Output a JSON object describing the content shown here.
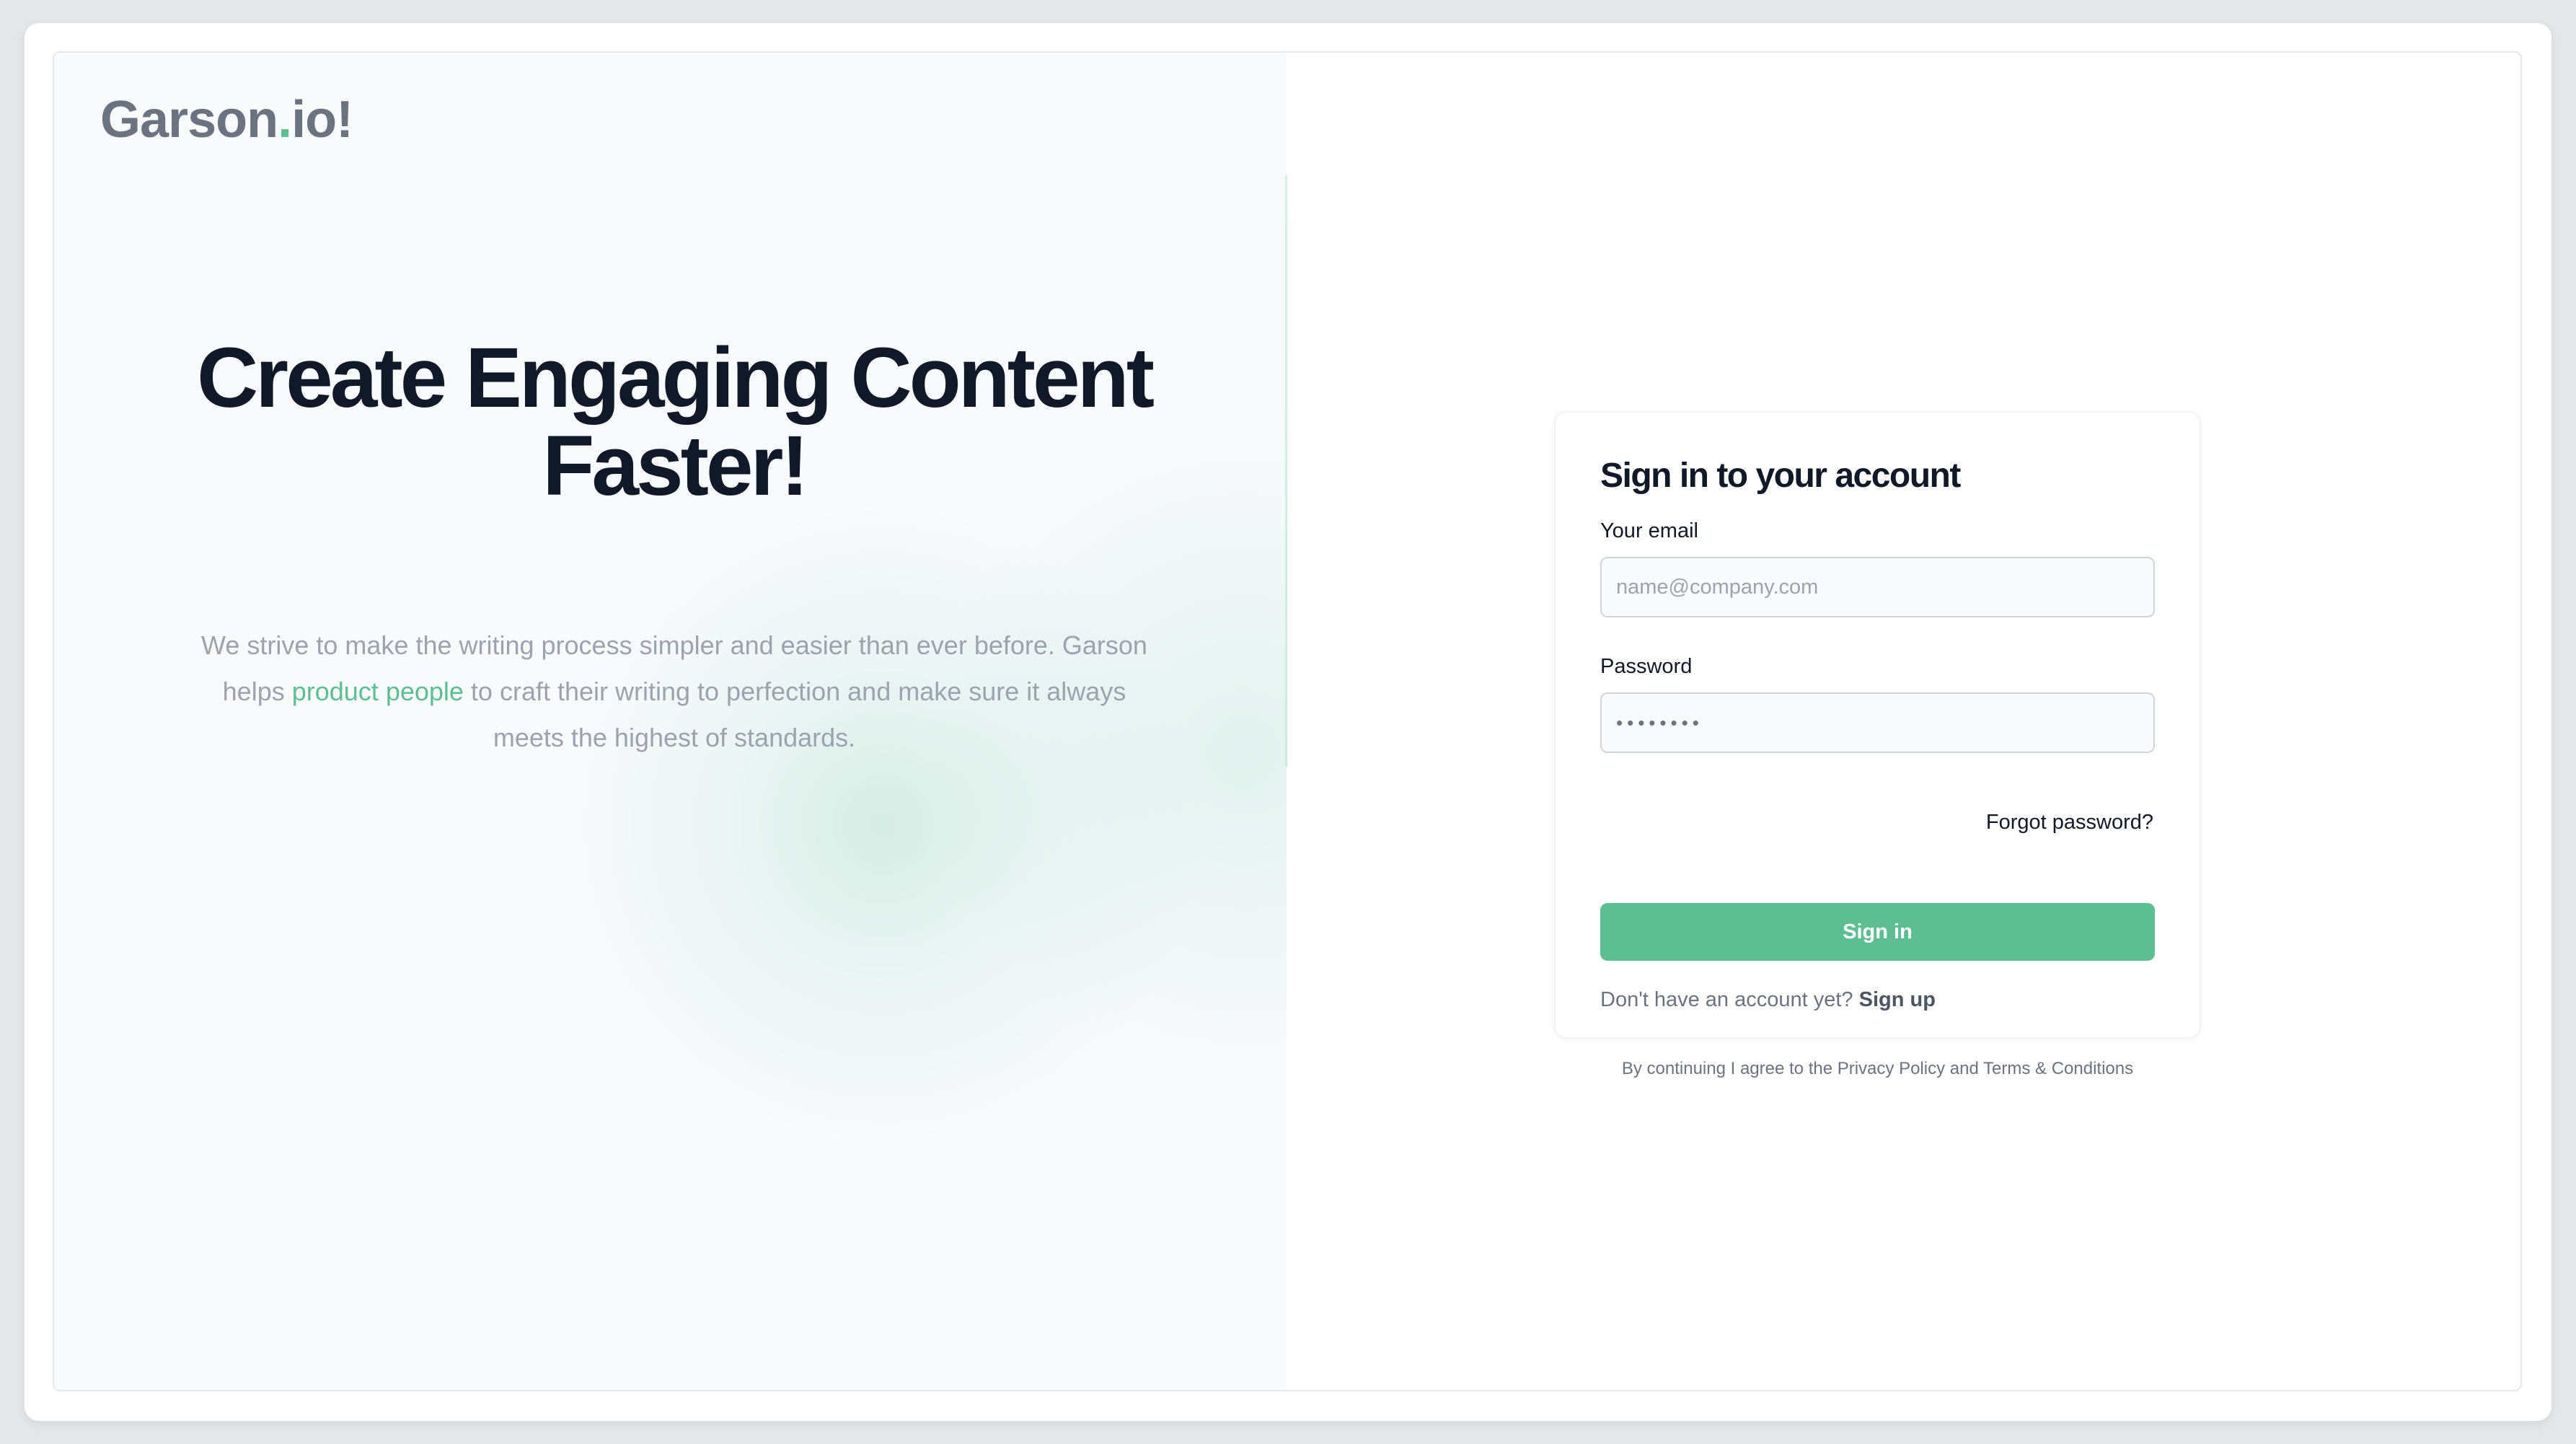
{
  "brand": {
    "name_part1": "Garson",
    "name_dot": ".",
    "name_part2": "io!"
  },
  "hero": {
    "headline_line1": "Create Engaging Content",
    "headline_line2": "Faster!",
    "description_part1": "We strive to make the writing process simpler and easier than ever before. Garson helps ",
    "description_highlight": "product people",
    "description_part2": " to craft their writing to perfection and make sure it always meets the highest of standards."
  },
  "signin": {
    "title": "Sign in to your account",
    "email_label": "Your email",
    "email_placeholder": "name@company.com",
    "password_label": "Password",
    "password_value": "••••••••",
    "forgot_link": "Forgot password?",
    "submit_label": "Sign in",
    "no_account_text": "Don't have an account yet?",
    "signup_link": "Sign up"
  },
  "footer": {
    "agreement": "By continuing I agree to the Privacy Policy and Terms & Conditions"
  },
  "colors": {
    "accent": "#5cbe92",
    "heading": "#111827",
    "muted": "#9ca3af",
    "left_panel_bg": "#f8fafc"
  }
}
